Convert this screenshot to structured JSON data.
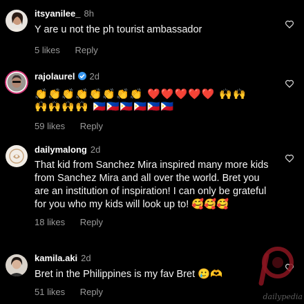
{
  "comments": [
    {
      "username": "itsyanilee_",
      "time": "8h",
      "verified": false,
      "text": "Y are u not the ph tourist ambassador",
      "likes": "5 likes",
      "reply": "Reply"
    },
    {
      "username": "rajolaurel",
      "time": "2d",
      "verified": true,
      "text_line1": "👏👏👏👏👏👏👏👏 ❤️❤️❤️❤️❤️ 🙌🙌",
      "text_line2": "🙌🙌🙌🙌 🇵🇭🇵🇭🇵🇭🇵🇭🇵🇭🇵🇭",
      "likes": "59 likes",
      "reply": "Reply"
    },
    {
      "username": "dailymalong",
      "time": "2d",
      "verified": false,
      "text": "That kid from Sanchez Mira inspired many more kids from Sanchez Mira and all over the world. Bret you are an institution of inspiration!  I can only be grateful for you who my kids will look up to! 🥰🥰🥰",
      "likes": "18 likes",
      "reply": "Reply"
    },
    {
      "username": "kamila.aki",
      "time": "2d",
      "verified": false,
      "text": "Bret in the Philippines is my fav Bret 🥲🫶",
      "likes": "51 likes",
      "reply": "Reply"
    }
  ],
  "watermark": "dailypedia",
  "colors": {
    "background": "#000000",
    "muted": "#9a9a9a",
    "verified": "#3897f0"
  }
}
